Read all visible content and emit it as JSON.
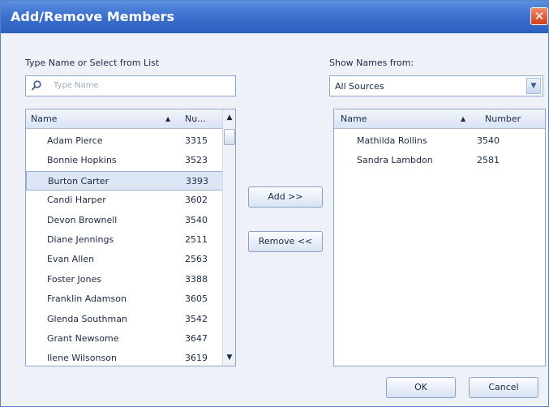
{
  "window": {
    "title": "Add/Remove Members",
    "close_glyph": "✕"
  },
  "left": {
    "label": "Type Name or Select from List",
    "search_placeholder": "Type Name",
    "columns": {
      "name": "Name",
      "number": "Nu..."
    },
    "rows": [
      {
        "name": "Adam Pierce",
        "number": "3315"
      },
      {
        "name": "Bonnie Hopkins",
        "number": "3523"
      },
      {
        "name": "Burton Carter",
        "number": "3393"
      },
      {
        "name": "Candi Harper",
        "number": "3602"
      },
      {
        "name": "Devon Brownell",
        "number": "3540"
      },
      {
        "name": "Diane Jennings",
        "number": "2511"
      },
      {
        "name": "Evan Allen",
        "number": "2563"
      },
      {
        "name": "Foster Jones",
        "number": "3388"
      },
      {
        "name": "Franklin Adamson",
        "number": "3605"
      },
      {
        "name": "Glenda Southman",
        "number": "3542"
      },
      {
        "name": "Grant Newsome",
        "number": "3647"
      },
      {
        "name": "Ilene Wilsonson",
        "number": "3619"
      }
    ],
    "selected_row": "Burton Carter"
  },
  "right": {
    "label": "Show Names from:",
    "source_value": "All Sources",
    "columns": {
      "name": "Name",
      "number": "Number"
    },
    "rows": [
      {
        "name": "Mathilda Rollins",
        "number": "3540"
      },
      {
        "name": "Sandra Lambdon",
        "number": "2581"
      }
    ]
  },
  "buttons": {
    "add": "Add >>",
    "remove": "Remove <<",
    "ok": "OK",
    "cancel": "Cancel"
  },
  "icons": {
    "sort": "sort-arrow-icon",
    "search": "search-icon",
    "dropdown": "chevron-down-icon"
  },
  "colors": {
    "title_bar": "#3d72cf",
    "close": "#d0401c",
    "accent_border": "#8fa7cc"
  }
}
